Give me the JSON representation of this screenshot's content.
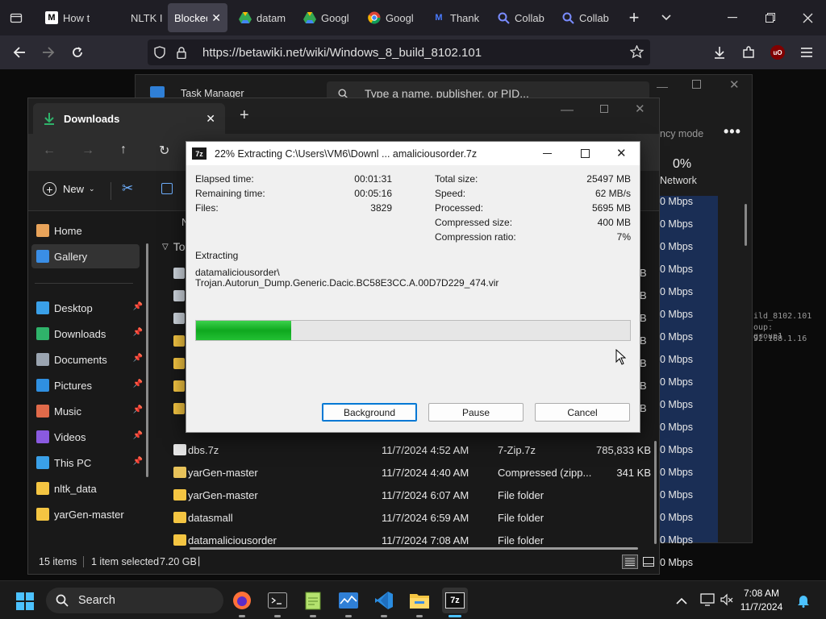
{
  "browser": {
    "tabs": [
      {
        "label": "How t",
        "icon": "medium-icon"
      },
      {
        "label": "NLTK I",
        "icon": "blank-icon"
      },
      {
        "label": "Blocked",
        "icon": "none",
        "active": true
      },
      {
        "label": "datam",
        "icon": "google-drive-icon"
      },
      {
        "label": "Googl",
        "icon": "google-drive-icon"
      },
      {
        "label": "Googl",
        "icon": "chrome-icon"
      },
      {
        "label": "Thank",
        "icon": "maltego-icon"
      },
      {
        "label": "Collab",
        "icon": "search-icon"
      },
      {
        "label": "Collab",
        "icon": "search-icon"
      }
    ],
    "url": "https://betawiki.net/wiki/Windows_8_build_8102.101",
    "ublock_badge": "uO"
  },
  "task_manager": {
    "title": "Task Manager",
    "search_placeholder": "Type a name, publisher, or PID...",
    "efficiency_mode": "ncy mode",
    "network_percent": "0%",
    "network_label": "Network",
    "network_rows": [
      "0 Mbps",
      "0 Mbps",
      "0 Mbps",
      "0 Mbps",
      "0 Mbps",
      "0 Mbps",
      "0 Mbps",
      "0 Mbps",
      "0 Mbps",
      "0 Mbps",
      "0 Mbps",
      "0 Mbps",
      "0 Mbps",
      "0 Mbps",
      "0 Mbps",
      "0 Mbps",
      "0 Mbps"
    ],
    "bg_text": [
      "ild_8102.101",
      "oup: group1",
      "92.168.1.16"
    ]
  },
  "explorer": {
    "tab_title": "Downloads",
    "new_label": "New",
    "column_partial": "N",
    "group_header": "To",
    "sidebar": [
      {
        "label": "Home",
        "icon": "home-icon",
        "color": "#e8a35a"
      },
      {
        "label": "Gallery",
        "icon": "gallery-icon",
        "color": "#3a8ee6",
        "selected": true
      },
      {
        "label": "Desktop",
        "icon": "desktop-icon",
        "color": "#3aa0e8",
        "pinned": true
      },
      {
        "label": "Downloads",
        "icon": "download-icon",
        "color": "#2fb36a",
        "pinned": true
      },
      {
        "label": "Documents",
        "icon": "document-icon",
        "color": "#9aa4b0",
        "pinned": true
      },
      {
        "label": "Pictures",
        "icon": "pictures-icon",
        "color": "#2f8fe0",
        "pinned": true
      },
      {
        "label": "Music",
        "icon": "music-icon",
        "color": "#e06a4a",
        "pinned": true
      },
      {
        "label": "Videos",
        "icon": "videos-icon",
        "color": "#8a5ae0",
        "pinned": true
      },
      {
        "label": "This PC",
        "icon": "computer-icon",
        "color": "#3aa0e8",
        "pinned": true
      },
      {
        "label": "nltk_data",
        "icon": "folder-icon",
        "color": "#f4c542"
      },
      {
        "label": "yarGen-master",
        "icon": "folder-icon",
        "color": "#f4c542"
      }
    ],
    "partial_sizes": [
      "B",
      "B",
      "B",
      "B",
      "B",
      "B",
      "B"
    ],
    "files": [
      {
        "name": "dbs.7z",
        "date": "11/7/2024 4:52 AM",
        "type": "7-Zip.7z",
        "size": "785,833 KB",
        "icon": "file-icon"
      },
      {
        "name": "yarGen-master",
        "date": "11/7/2024 4:40 AM",
        "type": "Compressed (zipp...",
        "size": "341 KB",
        "icon": "zip-folder-icon"
      },
      {
        "name": "yarGen-master",
        "date": "11/7/2024 6:07 AM",
        "type": "File folder",
        "size": "",
        "icon": "folder-icon"
      },
      {
        "name": "datasmall",
        "date": "11/7/2024 6:59 AM",
        "type": "File folder",
        "size": "",
        "icon": "folder-icon"
      },
      {
        "name": "datamaliciousorder",
        "date": "11/7/2024 7:08 AM",
        "type": "File folder",
        "size": "",
        "icon": "folder-icon"
      }
    ],
    "status": {
      "items": "15 items",
      "selected": "1 item selected",
      "size": "7.20 GB",
      "cursor": "|"
    }
  },
  "sevenzip": {
    "app_badge": "7z",
    "title": "22% Extracting C:\\Users\\VM6\\Downl ... amaliciousorder.7z",
    "left_stats": [
      {
        "label": "Elapsed time:",
        "value": "00:01:31"
      },
      {
        "label": "Remaining time:",
        "value": "00:05:16"
      },
      {
        "label": "Files:",
        "value": "3829"
      }
    ],
    "right_stats": [
      {
        "label": "Total size:",
        "value": "25497 MB"
      },
      {
        "label": "Speed:",
        "value": "62 MB/s"
      },
      {
        "label": "Processed:",
        "value": "5695 MB"
      },
      {
        "label": "Compressed size:",
        "value": "400 MB"
      },
      {
        "label": "Compression ratio:",
        "value": "7%"
      }
    ],
    "status_heading": "Extracting",
    "path_line1": "datamaliciousorder\\",
    "path_line2": "Trojan.Autorun_Dump.Generic.Dacic.BC58E3CC.A.00D7D229_474.vir",
    "progress_fraction": 0.22,
    "buttons": {
      "background": "Background",
      "pause": "Pause",
      "cancel": "Cancel"
    }
  },
  "taskbar": {
    "search_label": "Search",
    "time": "7:08 AM",
    "date": "11/7/2024"
  }
}
